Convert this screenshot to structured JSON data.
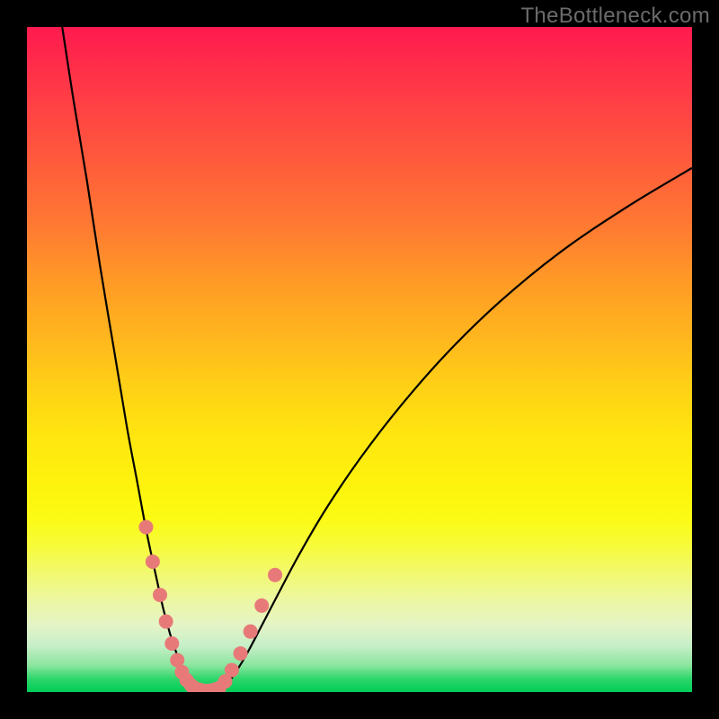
{
  "watermark": "TheBottleneck.com",
  "colors": {
    "frame": "#000000",
    "bead": "#e77a78",
    "curve": "#000000",
    "gradient_top": "#ff1a4f",
    "gradient_bottom": "#00cd55"
  },
  "chart_data": {
    "type": "line",
    "title": "",
    "xlabel": "",
    "ylabel": "",
    "xlim": [
      0,
      100
    ],
    "ylim": [
      0,
      100
    ],
    "series": [
      {
        "name": "left-curve",
        "x": [
          5.3,
          7,
          9,
          11,
          13,
          15,
          16.5,
          18,
          19.5,
          20.5,
          21.5,
          22.5,
          23.3,
          24.0,
          24.6,
          25.2,
          25.7
        ],
        "y": [
          100,
          89,
          77,
          64,
          52,
          40,
          32,
          24,
          17,
          12.5,
          8.8,
          5.8,
          3.6,
          2.1,
          1.1,
          0.45,
          0.15
        ]
      },
      {
        "name": "valley-floor",
        "x": [
          25.7,
          26.3,
          27.0,
          27.8,
          28.6
        ],
        "y": [
          0.15,
          0.05,
          0.0,
          0.05,
          0.15
        ]
      },
      {
        "name": "right-curve",
        "x": [
          28.6,
          29.4,
          30.4,
          31.6,
          33.2,
          35.2,
          37.8,
          41.0,
          45.0,
          50.0,
          56.0,
          63.0,
          71.0,
          80.0,
          90.0,
          100.0
        ],
        "y": [
          0.15,
          0.6,
          1.6,
          3.3,
          6.0,
          9.8,
          14.8,
          20.8,
          27.6,
          35.0,
          42.8,
          50.8,
          58.6,
          66.0,
          72.8,
          78.8
        ]
      }
    ],
    "beads_left": {
      "x": [
        17.9,
        18.9,
        20.0,
        20.9,
        21.8,
        22.6,
        23.3,
        24.0,
        24.7,
        25.4
      ],
      "y": [
        24.8,
        19.6,
        14.6,
        10.6,
        7.3,
        4.8,
        3.0,
        1.8,
        1.0,
        0.5
      ],
      "r": [
        8,
        8,
        8,
        8,
        8,
        8,
        8,
        8,
        8,
        8
      ]
    },
    "beads_floor": {
      "x": [
        25.9,
        26.6,
        27.4,
        28.2
      ],
      "y": [
        0.2,
        0.05,
        0.05,
        0.2
      ],
      "r": [
        9,
        9,
        9,
        9
      ]
    },
    "beads_right": {
      "x": [
        28.9,
        29.8,
        30.8,
        32.1,
        33.6,
        35.3,
        37.3
      ],
      "y": [
        0.6,
        1.6,
        3.3,
        5.8,
        9.1,
        13.0,
        17.6
      ],
      "r": [
        8,
        8,
        8,
        8,
        8,
        8,
        8
      ]
    }
  }
}
